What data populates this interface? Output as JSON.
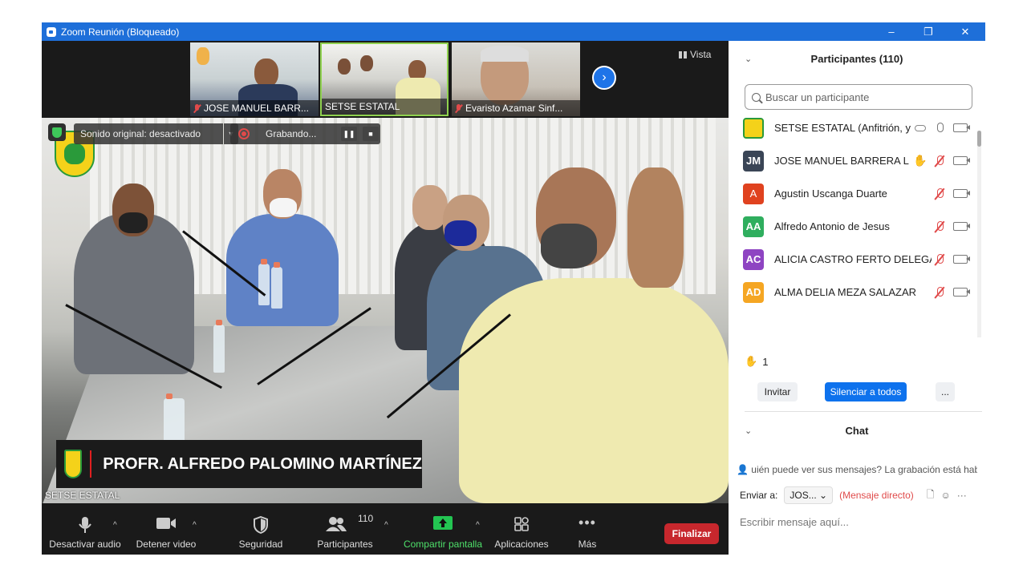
{
  "window": {
    "title": "Zoom Reunión (Bloqueado)",
    "controls": [
      "–",
      "❐",
      "✕"
    ]
  },
  "thumbnails": [
    {
      "name": "JOSE MANUEL BARR...",
      "muted": true
    },
    {
      "name": "SETSE ESTATAL",
      "muted": false
    },
    {
      "name": "Evaristo Azamar Sinf...",
      "muted": true
    }
  ],
  "view_label": "Vista",
  "sound_label": "Sonido original: desactivado",
  "recording_label": "Grabando...",
  "speaker": {
    "banner": "PROFR. ALFREDO PALOMINO MARTÍNEZ",
    "tile_name": "SETSE ESTATAL"
  },
  "toolbar": {
    "mute_label": "Desactivar audio",
    "video_label": "Detener video",
    "security_label": "Seguridad",
    "participants_label": "Participantes",
    "participants_count": "110",
    "share_label": "Compartir pantalla",
    "apps_label": "Aplicaciones",
    "more_label": "Más",
    "end_label": "Finalizar"
  },
  "participants_panel": {
    "title": "Participantes (110)",
    "search_placeholder": "Buscar un participante",
    "raised_count": "1",
    "invite_label": "Invitar",
    "mute_all_label": "Silenciar a todos",
    "more_label": "...",
    "list": [
      {
        "name": "SETSE ESTATAL (Anfitrión, yo)",
        "initials": "",
        "color": "#f4d21a",
        "muted": false
      },
      {
        "name": "JOSE MANUEL BARRERA L...",
        "initials": "JM",
        "color": "#3a4556",
        "muted": true,
        "hand": true
      },
      {
        "name": "Agustin Uscanga Duarte",
        "initials": "A",
        "color": "#e0421f",
        "muted": true
      },
      {
        "name": "Alfredo Antonio de Jesus",
        "initials": "AA",
        "color": "#2fae5e",
        "muted": true
      },
      {
        "name": "ALICIA CASTRO FERTO DELEGAC...",
        "initials": "AC",
        "color": "#8e44c2",
        "muted": true
      },
      {
        "name": "ALMA DELIA MEZA SALAZAR",
        "initials": "AD",
        "color": "#f5a623",
        "muted": true
      }
    ]
  },
  "chat": {
    "title": "Chat",
    "notice": "uién puede ver sus mensajes? La grabación está habilit",
    "send_to_label": "Enviar a:",
    "send_to_value": "JOS...",
    "direct_label": "(Mensaje directo)",
    "input_placeholder": "Escribir mensaje aquí..."
  }
}
